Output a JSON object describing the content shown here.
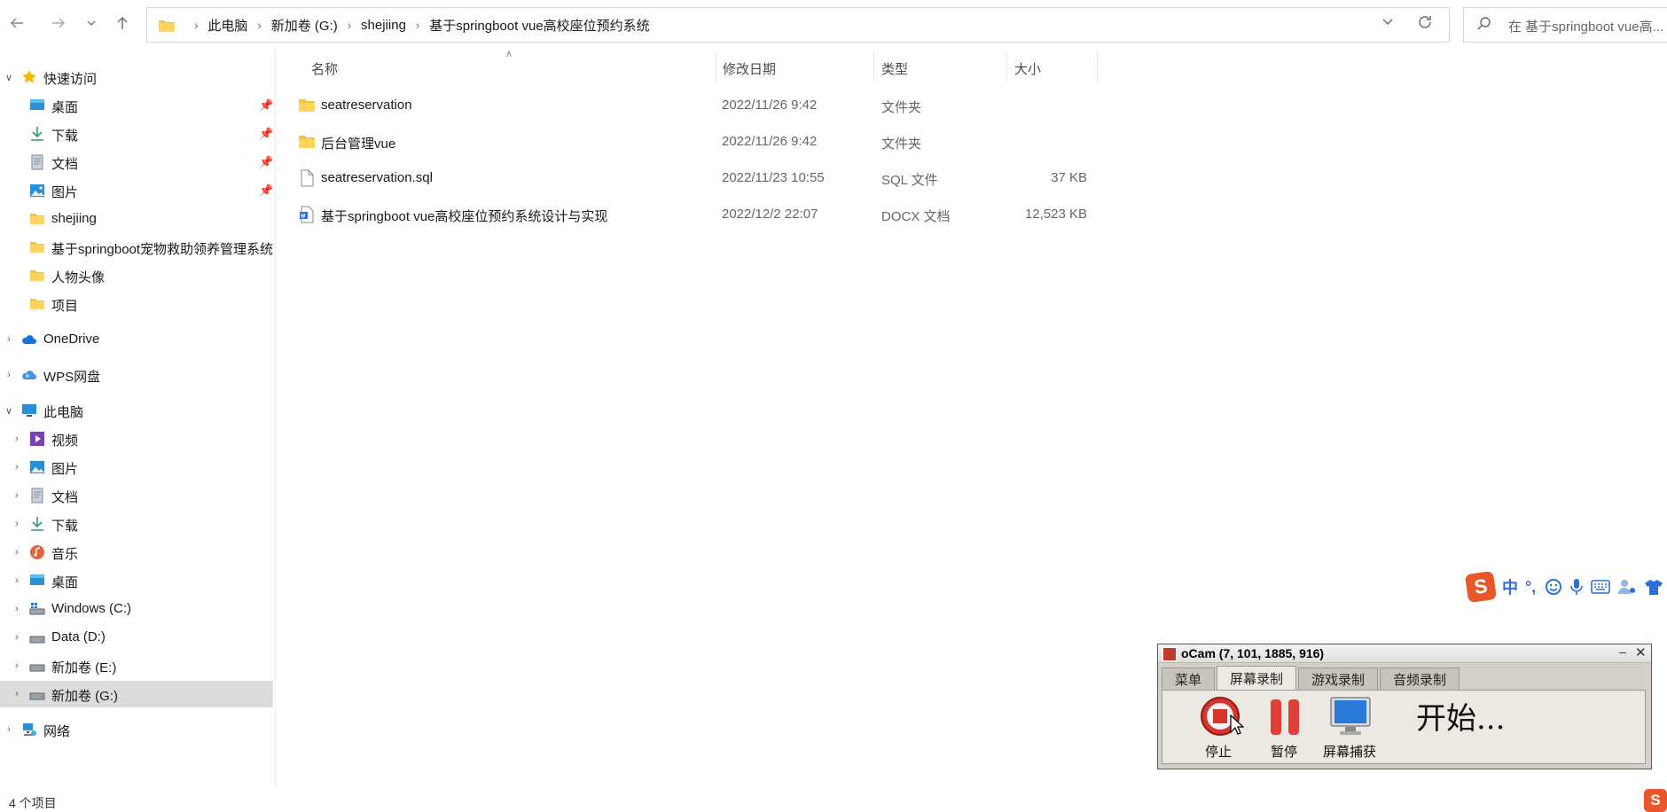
{
  "breadcrumb": [
    "此电脑",
    "新加卷 (G:)",
    "shejiing",
    "基于springboot vue高校座位预约系统"
  ],
  "search": {
    "placeholder": "在 基于springboot vue高..."
  },
  "sidebar": {
    "quick_access": {
      "label": "快速访问",
      "items": [
        {
          "label": "桌面",
          "icon": "desktop-icon",
          "pinned": true
        },
        {
          "label": "下载",
          "icon": "download-icon",
          "pinned": true
        },
        {
          "label": "文档",
          "icon": "document-icon",
          "pinned": true
        },
        {
          "label": "图片",
          "icon": "picture-icon",
          "pinned": true
        },
        {
          "label": "shejiing",
          "icon": "folder-icon",
          "pinned": false
        },
        {
          "label": "基于springboot宠物救助领养管理系统",
          "icon": "folder-icon",
          "pinned": false
        },
        {
          "label": "人物头像",
          "icon": "folder-icon",
          "pinned": false
        },
        {
          "label": "项目",
          "icon": "folder-icon",
          "pinned": false
        }
      ]
    },
    "onedrive": {
      "label": "OneDrive"
    },
    "wps": {
      "label": "WPS网盘"
    },
    "this_pc": {
      "label": "此电脑",
      "items": [
        {
          "label": "视频",
          "icon": "video-icon"
        },
        {
          "label": "图片",
          "icon": "picture-icon"
        },
        {
          "label": "文档",
          "icon": "document-icon"
        },
        {
          "label": "下载",
          "icon": "download-icon"
        },
        {
          "label": "音乐",
          "icon": "music-icon"
        },
        {
          "label": "桌面",
          "icon": "desktop-icon"
        },
        {
          "label": "Windows (C:)",
          "icon": "drive-icon"
        },
        {
          "label": "Data (D:)",
          "icon": "drive-icon"
        },
        {
          "label": "新加卷 (E:)",
          "icon": "drive-icon"
        },
        {
          "label": "新加卷 (G:)",
          "icon": "drive-icon",
          "selected": true
        }
      ]
    },
    "network": {
      "label": "网络"
    }
  },
  "columns": {
    "name": "名称",
    "modified": "修改日期",
    "type": "类型",
    "size": "大小"
  },
  "files": [
    {
      "name": "seatreservation",
      "modified": "2022/11/26 9:42",
      "type": "文件夹",
      "size": "",
      "icon": "folder-icon"
    },
    {
      "name": "后台管理vue",
      "modified": "2022/11/26 9:42",
      "type": "文件夹",
      "size": "",
      "icon": "folder-icon"
    },
    {
      "name": "seatreservation.sql",
      "modified": "2022/11/23 10:55",
      "type": "SQL 文件",
      "size": "37 KB",
      "icon": "file-icon"
    },
    {
      "name": "基于springboot vue高校座位预约系统设计与实现",
      "modified": "2022/12/2 22:07",
      "type": "DOCX 文档",
      "size": "12,523 KB",
      "icon": "docx-icon"
    }
  ],
  "status": {
    "item_count": "4 个项目"
  },
  "ime": {
    "logo": "S",
    "lang": "中",
    "punct": "°,"
  },
  "ocam": {
    "title": "oCam (7, 101, 1885, 916)",
    "tabs": [
      "菜单",
      "屏幕录制",
      "游戏录制",
      "音频录制"
    ],
    "active_tab": "屏幕录制",
    "buttons": {
      "stop": "停止",
      "pause": "暂停",
      "capture": "屏幕捕获"
    },
    "status": "开始..."
  },
  "colors": {
    "folder": "#f5c342",
    "selected_row": "#dcdcdc",
    "ocam_bg": "#d4d0c8",
    "record_red": "#d8342c"
  }
}
